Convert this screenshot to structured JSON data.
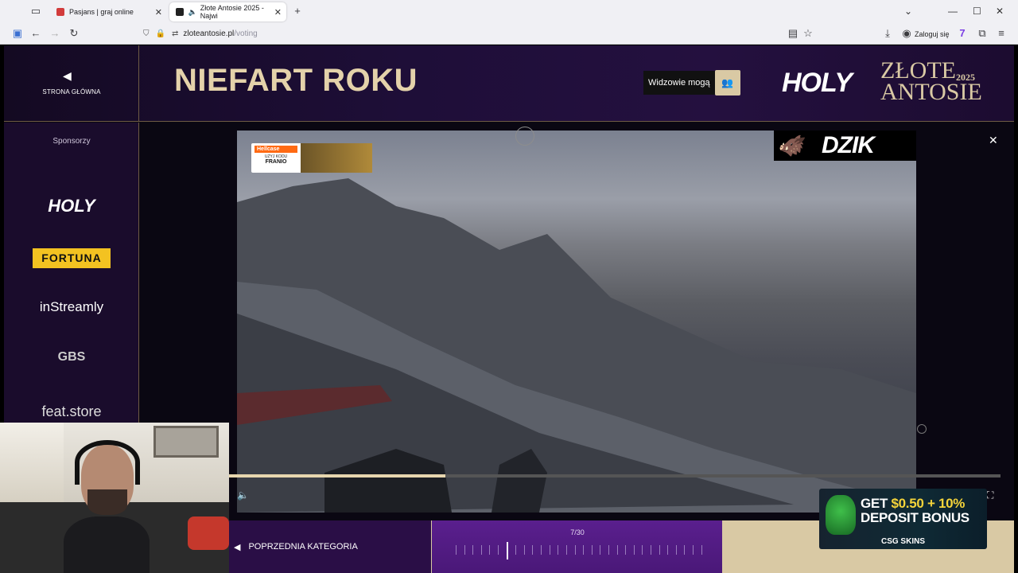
{
  "browser": {
    "tabs": [
      {
        "title": "Pasjans | graj online",
        "active": false
      },
      {
        "title": "Złote Antosie 2025 - Najwi",
        "active": true
      }
    ],
    "url_domain": "zloteantosie.pl",
    "url_path": "/voting",
    "login_label": "Zaloguj się"
  },
  "header": {
    "home_label": "STRONA GŁÓWNA",
    "category_title": "NIEFART ROKU",
    "viewers_label": "Widzowie mogą",
    "logo_holy": "HOLY",
    "logo_zlote": "ZŁOTE",
    "logo_antosie": "ANTOSIE",
    "logo_year": "2025"
  },
  "sidebar": {
    "title": "Sponsorzy",
    "sponsors": [
      "HOLY",
      "FORTUNA",
      "inStreamly",
      "GBS",
      "feat.store"
    ]
  },
  "video": {
    "overlay_brand": "Hellcase",
    "overlay_sub": "UŻYJ KODU",
    "overlay_code": "FRANIO",
    "sponsor_badge": "DZIK",
    "progress": 0.28
  },
  "bottom": {
    "prev_label": "POPRZEDNIA KATEGORIA",
    "counter": "7/30",
    "current_index": 7,
    "total": 30
  },
  "ad": {
    "line1_prefix": "GET ",
    "line1_amount": "$0.50 + 10%",
    "line2": "DEPOSIT BONUS",
    "brand": "CSG SKINS"
  },
  "colors": {
    "gold": "#d9c9a4",
    "purple_dark": "#1a0c2c",
    "purple_bar": "#4a1878"
  }
}
